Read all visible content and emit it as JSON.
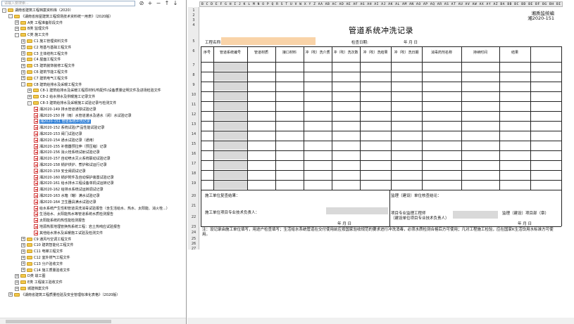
{
  "search": {
    "placeholder": "请输入要搜索..."
  },
  "toolbar": {
    "b1": "⊘",
    "b2": "+",
    "b3": "−",
    "b4": "↑",
    "b5": "↓"
  },
  "tree": [
    {
      "label": "湖南省建筑工程档案资料库（2020）",
      "indent": 0,
      "kind": "folder",
      "exp": "-"
    },
    {
      "label": "《湖南省房屋建筑工程现场技术资料统一用表》（2020版）",
      "indent": 1,
      "kind": "folder",
      "exp": "-"
    },
    {
      "label": "A类  工程准备阶段文件",
      "indent": 2,
      "kind": "folder",
      "exp": "+"
    },
    {
      "label": "B类  监理文件",
      "indent": 2,
      "kind": "folder",
      "exp": "+"
    },
    {
      "label": "C类  施工文件",
      "indent": 2,
      "kind": "folder",
      "exp": "-"
    },
    {
      "label": "C1 施工管理资料文件",
      "indent": 3,
      "kind": "folder",
      "exp": "+"
    },
    {
      "label": "C2 地基与基础工程文件",
      "indent": 3,
      "kind": "folder",
      "exp": "+"
    },
    {
      "label": "C3 主体结构工程文件",
      "indent": 3,
      "kind": "folder",
      "exp": "+"
    },
    {
      "label": "C4 屋面工程文件",
      "indent": 3,
      "kind": "folder",
      "exp": "+"
    },
    {
      "label": "C5 建筑装饰装修工程文件",
      "indent": 3,
      "kind": "folder",
      "exp": "+"
    },
    {
      "label": "C6 建筑节能工程文件",
      "indent": 3,
      "kind": "folder",
      "exp": "+"
    },
    {
      "label": "C7 建筑电气工程文件",
      "indent": 3,
      "kind": "folder",
      "exp": "+"
    },
    {
      "label": "C8 建筑给排水及采暖工程文件",
      "indent": 3,
      "kind": "folder",
      "exp": "-"
    },
    {
      "label": "C8-1 建筑给排水及采暖工程原材料/构配件/设备质量证明文件及进场检验文件",
      "indent": 4,
      "kind": "folder",
      "exp": "+"
    },
    {
      "label": "C8-2 给水排水及供暖施工记录文件",
      "indent": 4,
      "kind": "folder",
      "exp": "+"
    },
    {
      "label": "C8-3 建筑给排水及采暖施工试验记录与检测文件",
      "indent": 4,
      "kind": "folder",
      "exp": "-"
    },
    {
      "label": "湘2020-149 排水管道通球试验记录",
      "indent": 5,
      "kind": "doc",
      "exp": ""
    },
    {
      "label": "湘2020-150 排（雨）水管道灌水及通水（闭）水试验记录",
      "indent": 5,
      "kind": "doc",
      "exp": ""
    },
    {
      "label": "湘2020-151 管道系统冲洗记录",
      "indent": 5,
      "kind": "doc",
      "exp": "",
      "selected": true
    },
    {
      "label": "湘2020-152 系统试验/产品性能试验记录",
      "indent": 5,
      "kind": "doc",
      "exp": ""
    },
    {
      "label": "湘2020-153 阀门试验记录",
      "indent": 5,
      "kind": "doc",
      "exp": ""
    },
    {
      "label": "湘2020-154 通水试验记录（通用）",
      "indent": 5,
      "kind": "doc",
      "exp": ""
    },
    {
      "label": "湘2020-155 补偿器预拉伸（预压缩）记录",
      "indent": 5,
      "kind": "doc",
      "exp": ""
    },
    {
      "label": "湘2020-156 消火栓系统试射试验记录",
      "indent": 5,
      "kind": "doc",
      "exp": ""
    },
    {
      "label": "湘2020-157 自动喷水灭火系统联动试验记录",
      "indent": 5,
      "kind": "doc",
      "exp": ""
    },
    {
      "label": "湘2020-158 锅炉烘炉、煮炉和试运行记录",
      "indent": 5,
      "kind": "doc",
      "exp": ""
    },
    {
      "label": "湘2020-159 安全阀调试记录",
      "indent": 5,
      "kind": "doc",
      "exp": ""
    },
    {
      "label": "湘2020-160 锅炉附件及自动保护装置试验记录",
      "indent": 5,
      "kind": "doc",
      "exp": ""
    },
    {
      "label": "湘2020-161 给水排水工程设备单机试运转记录",
      "indent": 5,
      "kind": "doc",
      "exp": ""
    },
    {
      "label": "湘2020-162 给排水系统试运转调试记录",
      "indent": 5,
      "kind": "doc",
      "exp": ""
    },
    {
      "label": "湘2020-163 水箱（罐）满水试验记录",
      "indent": 5,
      "kind": "doc",
      "exp": ""
    },
    {
      "label": "湘2020-164 卫生器具满水试验记录",
      "indent": 5,
      "kind": "doc",
      "exp": ""
    },
    {
      "label": "给水系统产生性和管道清洗消毒试验报告（含生活给水、热水、太阳能、消火栓...）",
      "indent": 5,
      "kind": "doc",
      "exp": ""
    },
    {
      "label": "生活给水、太阳能热水等管道系统水质检测报告",
      "indent": 5,
      "kind": "doc",
      "exp": ""
    },
    {
      "label": "太阳能系统的热性能检测报告",
      "indent": 5,
      "kind": "doc",
      "exp": ""
    },
    {
      "label": "地源热泵地埋管换热系统工程：岩土热响应试验报告",
      "indent": 5,
      "kind": "doc",
      "exp": ""
    },
    {
      "label": "其他给水排水及采暖施工试验及检测文件",
      "indent": 5,
      "kind": "doc",
      "exp": ""
    },
    {
      "label": "C9 通风与空调工程文件",
      "indent": 3,
      "kind": "folder",
      "exp": "+"
    },
    {
      "label": "C10 建筑智能化工程文件",
      "indent": 3,
      "kind": "folder",
      "exp": "+"
    },
    {
      "label": "C11 电梯工程文件",
      "indent": 3,
      "kind": "folder",
      "exp": "+"
    },
    {
      "label": "C12 室外燃气工程文件",
      "indent": 3,
      "kind": "folder",
      "exp": "+"
    },
    {
      "label": "C13 分户验收文件",
      "indent": 3,
      "kind": "folder",
      "exp": "+"
    },
    {
      "label": "C14 施工质量验收文件",
      "indent": 3,
      "kind": "folder",
      "exp": "+"
    },
    {
      "label": "D类  竣工图",
      "indent": 2,
      "kind": "folder",
      "exp": "+"
    },
    {
      "label": "E类  工程竣工验收文件",
      "indent": 2,
      "kind": "folder",
      "exp": "+"
    },
    {
      "label": "城建档案文件",
      "indent": 2,
      "kind": "folder",
      "exp": "+"
    },
    {
      "label": "《湖南省建筑工程质量检验及安全管理标准化表格》（2020版）",
      "indent": 1,
      "kind": "folder",
      "exp": "+"
    }
  ],
  "sheet": {
    "columns_header": "B C D E F G H I J K L M N O P Q R S T U V W X Y Z AA AB AC AD AE AF AG AH AI AJ AK AL AM AN AO AP AQ AR AS AT AU AV AW AX AY AZ BA BB BC BD BE BF BG BH BI BJ BK",
    "row_numbers": [
      "1",
      "2",
      "3",
      "4",
      "5",
      "6",
      "7",
      "8",
      "9",
      "10",
      "11",
      "12",
      "13",
      "14",
      "15",
      "16",
      "17",
      "18",
      "19",
      "20",
      "21",
      "22",
      "23",
      "24",
      "25",
      "26",
      "27"
    ],
    "corner_top": "湘质监统编",
    "corner_code": "湘2020-151",
    "title": "管道系统冲洗记录",
    "project_label": "工程名称:",
    "date_label": "检查日期:",
    "date_value": "年   月   日",
    "headers": [
      "序号",
      "管道系统编号",
      "管道材质",
      "接口材料",
      "冲（吹）洗介质",
      "冲（吹）洗次数",
      "冲（吹）洗结果",
      "冲（吹）洗日期",
      "消毒药剂名称",
      "持续时间",
      "结果"
    ],
    "labels": {
      "constr_result": "施工单位复查结果：",
      "supervision": "监理（建设）单位核查结论：",
      "constr_tech": "施工单位项目专业技术负责人：",
      "qa_engineer": "项目专业监理工程师\n（建设单位项目专业技术负责人）",
      "sup_seal": "监理（建设）项目部（章）",
      "ymd1": "年   月   日",
      "ymd2": "年   月   日",
      "note": "注：设记录由施工单位填写，用途户检查填写；生活给水系统管道在交付使用前应按国家验收规范的要求进行冲洗消毒，必须水质检测合格后方可使用；凡对工程施工检验，应在国家K生活饮用水标准方可使用。"
    }
  }
}
